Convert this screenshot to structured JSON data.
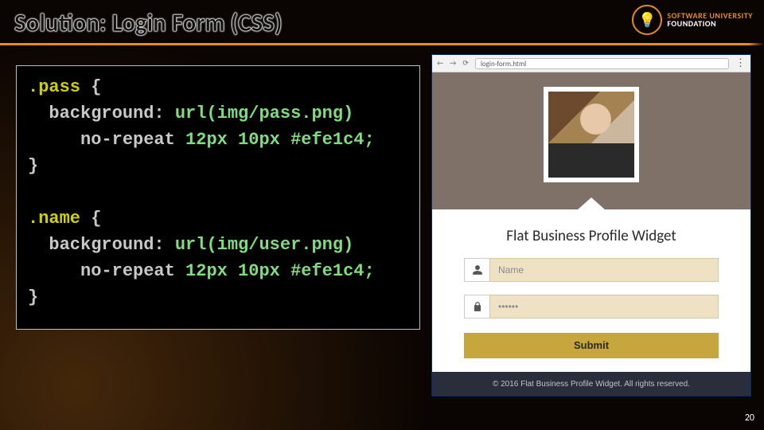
{
  "slide": {
    "title": "Solution: Login Form (CSS)",
    "page_number": "20"
  },
  "logo": {
    "line1": "SOFTWARE UNIVERSITY",
    "line2": "FOUNDATION",
    "bulb": "💡"
  },
  "code": {
    "selector_pass": ".pass",
    "open_brace": " {",
    "bg_label": "  background: ",
    "pass_url": "url(img/pass.png)",
    "repeat_label": "     no-repeat ",
    "pass_vals": "12px 10px #efe1c4;",
    "close_brace": "}",
    "selector_name": ".name",
    "name_url": "url(img/user.png)",
    "name_vals": "12px 10px #efe1c4;"
  },
  "browser": {
    "address": "login-form.html",
    "widget_title": "Flat Business Profile Widget",
    "name_placeholder": "Name",
    "pass_placeholder": "••••••",
    "submit_label": "Submit",
    "footer_text": "© 2016 Flat Business Profile Widget. All rights reserved."
  }
}
